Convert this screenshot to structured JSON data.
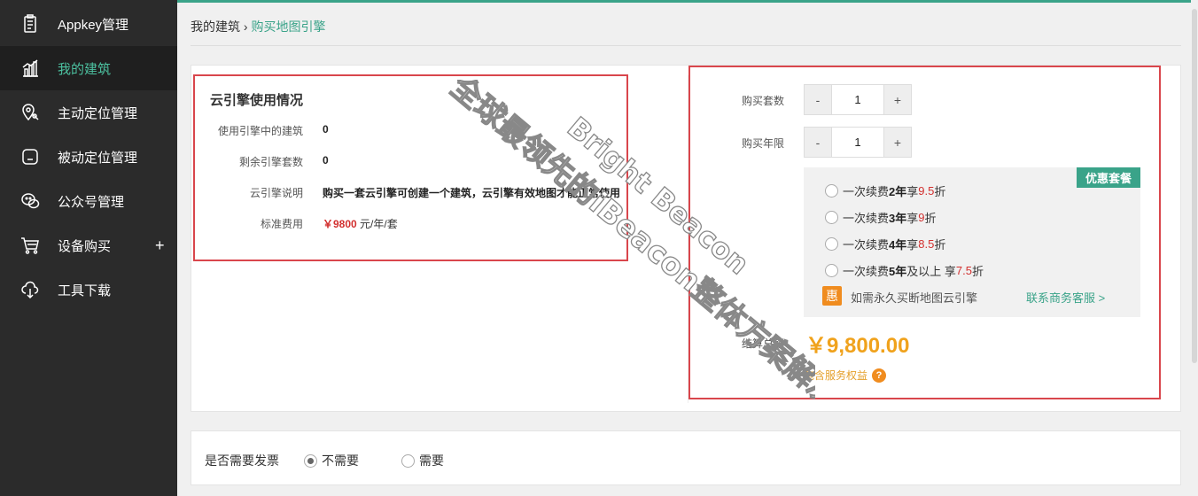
{
  "sidebar": {
    "items": [
      {
        "label": "Appkey管理",
        "icon": "clipboard-icon"
      },
      {
        "label": "我的建筑",
        "icon": "building-chart-icon"
      },
      {
        "label": "主动定位管理",
        "icon": "location-pin-icon"
      },
      {
        "label": "被动定位管理",
        "icon": "device-tag-icon"
      },
      {
        "label": "公众号管理",
        "icon": "wechat-icon"
      },
      {
        "label": "设备购买",
        "icon": "cart-icon",
        "expand": "+"
      },
      {
        "label": "工具下载",
        "icon": "cloud-download-icon"
      }
    ]
  },
  "breadcrumb": {
    "parent": "我的建筑",
    "separator": " › ",
    "current": "购买地图引擎"
  },
  "usage": {
    "title": "云引擎使用情况",
    "rows": [
      {
        "label": "使用引擎中的建筑",
        "value": "0"
      },
      {
        "label": "剩余引擎套数",
        "value": "0"
      },
      {
        "label": "云引擎说明",
        "value": "购买一套云引擎可创建一个建筑，云引擎有效地图才能正常使用"
      }
    ],
    "price_label": "标准费用",
    "price_value": "￥9800",
    "price_unit": " 元/年/套"
  },
  "purchase": {
    "sets_label": "购买套数",
    "sets_value": "1",
    "years_label": "购买年限",
    "years_value": "1",
    "minus": "-",
    "plus": "+",
    "promo_badge": "优惠套餐",
    "promo_options": [
      {
        "pre": "一次续费",
        "bold": "2年",
        "mid": " 享",
        "red": "9.5",
        "post": "折"
      },
      {
        "pre": "一次续费",
        "bold": "3年",
        "mid": " 享",
        "red": "9",
        "post": "折"
      },
      {
        "pre": "一次续费",
        "bold": "4年",
        "mid": " 享",
        "red": "8.5",
        "post": "折"
      },
      {
        "pre": "一次续费",
        "bold": "5年",
        "mid": "及以上 享",
        "red": "7.5",
        "post": "折"
      }
    ],
    "hui": "惠",
    "forever_text": "如需永久买断地图云引擎",
    "contact_link": "联系商务客服 >",
    "total_label": "结算总额",
    "total_value": "￥9,800.00",
    "benefits_label": "包含服务权益",
    "benefits_icon": "?"
  },
  "invoice": {
    "label": "是否需要发票",
    "options": [
      "不需要",
      "需要"
    ],
    "selected": "不需要"
  },
  "watermark": {
    "line1": "全球最领先的iBeacon整体方案解决商",
    "line2": "Bright Beacon"
  },
  "colors": {
    "accent": "#3aa389",
    "highlight_border": "#d9464c",
    "price_red": "#d2302f",
    "total_orange": "#f0a21c"
  }
}
